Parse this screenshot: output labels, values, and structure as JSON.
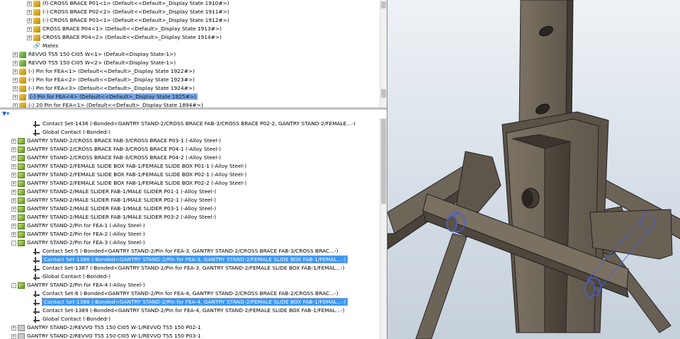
{
  "top_tree": [
    {
      "text": "(f) CROSS BRACE P01<1> (Default<<Default>_Display State 1910#>)",
      "kind": "part",
      "indent": 38,
      "expander": "+"
    },
    {
      "text": "(-) CROSS BRACE P02<2> (Default<<Default>_Display State 1911#>)",
      "kind": "part",
      "indent": 38,
      "expander": "+"
    },
    {
      "text": "(-) CROSS BRACE P03<1> (Default<<Default>_Display State 1912#>)",
      "kind": "part",
      "indent": 38,
      "expander": "+"
    },
    {
      "text": "CROSS BRACE P04<1> (Default<<Default>_Display State 1913#>)",
      "kind": "part",
      "indent": 38,
      "expander": "+"
    },
    {
      "text": "CROSS BRACE P04<2> (Default<<Default>_Display State 1914#>)",
      "kind": "part",
      "indent": 38,
      "expander": "+"
    },
    {
      "text": "Mates",
      "kind": "mates",
      "indent": 38,
      "expander": ""
    },
    {
      "text": "REVVO TS5 150 CI05 W<1> (Default<Display State-1>)",
      "kind": "asm",
      "indent": 18,
      "expander": "+"
    },
    {
      "text": "REVVO TS5 150 CI05 W<2> (Default<Display State-1>)",
      "kind": "asm",
      "indent": 18,
      "expander": "+"
    },
    {
      "text": "(-) Pin for FEA<1> (Default<<Default>_Display State 1922#>)",
      "kind": "part",
      "indent": 18,
      "expander": "+"
    },
    {
      "text": "(-) Pin for FEA<2> (Default<<Default>_Display State 1923#>)",
      "kind": "part",
      "indent": 18,
      "expander": "+"
    },
    {
      "text": "(-) Pin for FEA<3> (Default<<Default>_Display State 1924#>)",
      "kind": "part",
      "indent": 18,
      "expander": "+"
    },
    {
      "text": "(-) Pin for FEA<4> (Default<<Default>_Display State 1925#>)",
      "kind": "part",
      "indent": 18,
      "expander": "+",
      "style": "selpart"
    },
    {
      "text": "(-) 20 Pin for FEA<1> (Default<<Default>_Display State 1894#>)",
      "kind": "part",
      "indent": 18,
      "expander": "+"
    }
  ],
  "bottom_tree": [
    {
      "text": "Contact Set-1436 (-Bonded<GANTRY STAND-2/CROSS BRACE FAB-3/CROSS BRACE P02-2, GANTRY STAND-2/FEMALE...-)",
      "kind": "contact",
      "indent": 38,
      "expander": ""
    },
    {
      "text": "Global Contact (-Bonded-)",
      "kind": "contact",
      "indent": 38,
      "expander": ""
    },
    {
      "text": "GANTRY STAND-2/CROSS BRACE FAB-3/CROSS BRACE P03-1 (-Alloy Steel-)",
      "kind": "grn",
      "indent": 16,
      "expander": "+"
    },
    {
      "text": "GANTRY STAND-2/CROSS BRACE FAB-3/CROSS BRACE P04-1 (-Alloy Steel-)",
      "kind": "grn",
      "indent": 16,
      "expander": "+"
    },
    {
      "text": "GANTRY STAND-2/CROSS BRACE FAB-3/CROSS BRACE P04-2 (-Alloy Steel-)",
      "kind": "grn",
      "indent": 16,
      "expander": "+"
    },
    {
      "text": "GANTRY STAND-2/FEMALE SLIDE BOX FAB-1/FEMALE SLIDE BOX P01-1 (-Alloy Steel-)",
      "kind": "grn",
      "indent": 16,
      "expander": "+"
    },
    {
      "text": "GANTRY STAND-2/FEMALE SLIDE BOX FAB-1/FEMALE SLIDE BOX P02-1 (-Alloy Steel-)",
      "kind": "grn",
      "indent": 16,
      "expander": "+"
    },
    {
      "text": "GANTRY STAND-2/FEMALE SLIDE BOX FAB-1/FEMALE SLIDE BOX P02-2 (-Alloy Steel-)",
      "kind": "grn",
      "indent": 16,
      "expander": "+"
    },
    {
      "text": "GANTRY STAND-2/MALE SLIDER FAB-1/MALE SLIDER P01-1 (-Alloy Steel-)",
      "kind": "grn",
      "indent": 16,
      "expander": "+"
    },
    {
      "text": "GANTRY STAND-2/MALE SLIDER FAB-1/MALE SLIDER P02-1 (-Alloy Steel-)",
      "kind": "grn",
      "indent": 16,
      "expander": "+"
    },
    {
      "text": "GANTRY STAND-2/MALE SLIDER FAB-1/MALE SLIDER P03-1 (-Alloy Steel-)",
      "kind": "grn",
      "indent": 16,
      "expander": "+"
    },
    {
      "text": "GANTRY STAND-2/MALE SLIDER FAB-1/MALE SLIDER P03-2 (-Alloy Steel-)",
      "kind": "grn",
      "indent": 16,
      "expander": "+"
    },
    {
      "text": "GANTRY STAND-2/Pin for FEA-1 (-Alloy Steel-)",
      "kind": "grn",
      "indent": 16,
      "expander": "+"
    },
    {
      "text": "GANTRY STAND-2/Pin for FEA-2 (-Alloy Steel-)",
      "kind": "grn",
      "indent": 16,
      "expander": "+"
    },
    {
      "text": "GANTRY STAND-2/Pin for FEA-3 (-Alloy Steel-)",
      "kind": "grn",
      "indent": 16,
      "expander": "-"
    },
    {
      "text": "Contact Set-5 (-Bonded<GANTRY STAND-2/Pin for FEA-3, GANTRY STAND-2/CROSS BRACE FAB-3/CROSS BRAC...-)",
      "kind": "contact",
      "indent": 38,
      "expander": ""
    },
    {
      "text": "Contact Set-1386 (-Bonded<GANTRY STAND-2/Pin for FEA-3, GANTRY STAND-2/FEMALE SLIDE BOX FAB-1/FEMAL...-)",
      "kind": "contact",
      "indent": 38,
      "expander": "",
      "style": "sel"
    },
    {
      "text": "Contact Set-1387 (-Bonded<GANTRY STAND-2/Pin for FEA-3, GANTRY STAND-2/FEMALE SLIDE BOX FAB-1/FEMAL...-)",
      "kind": "contact",
      "indent": 38,
      "expander": ""
    },
    {
      "text": "Global Contact (-Bonded-)",
      "kind": "contact",
      "indent": 38,
      "expander": ""
    },
    {
      "text": "GANTRY STAND-2/Pin for FEA-4 (-Alloy Steel-)",
      "kind": "grn",
      "indent": 16,
      "expander": "-"
    },
    {
      "text": "Contact Set-8 (-Bonded<GANTRY STAND-2/Pin for FEA-4, GANTRY STAND-2/CROSS BRACE FAB-2/CROSS BRAC...-)",
      "kind": "contact",
      "indent": 38,
      "expander": ""
    },
    {
      "text": "Contact Set-1388 (-Bonded<GANTRY STAND-2/Pin for FEA-4, GANTRY STAND-2/FEMALE SLIDE BOX FAB-1/FEMAL...-)",
      "kind": "contact",
      "indent": 38,
      "expander": "",
      "style": "sel"
    },
    {
      "text": "Contact Set-1389 (-Bonded<GANTRY STAND-2/Pin for FEA-4, GANTRY STAND-2/FEMALE SLIDE BOX FAB-1/FEMAL...-)",
      "kind": "contact",
      "indent": 38,
      "expander": ""
    },
    {
      "text": "Global Contact (-Bonded-)",
      "kind": "contact",
      "indent": 38,
      "expander": ""
    },
    {
      "text": "GANTRY STAND-2/REVVO TS5 150 CI05 W-1/REVVO TS5 150 P02-1",
      "kind": "gray",
      "indent": 16,
      "expander": "+"
    },
    {
      "text": "GANTRY STAND-2/REVVO TS5 150 CI05 W-1/REVVO TS5 150 P03-1",
      "kind": "gray",
      "indent": 16,
      "expander": "+"
    }
  ],
  "filter": {
    "icon": "filter-icon",
    "arrow": "▾"
  },
  "colors": {
    "selection": "#3399ff",
    "viewport_top": "#eef2f6",
    "steel": "#6e6558",
    "steel_dark": "#3a342c",
    "pin_highlight": "#4a5fd9"
  }
}
